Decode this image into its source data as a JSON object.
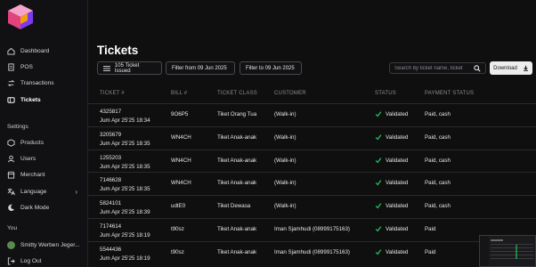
{
  "sidebar": {
    "items": [
      {
        "label": "Dashboard",
        "icon": "home-icon"
      },
      {
        "label": "POS",
        "icon": "receipt-icon"
      },
      {
        "label": "Transactions",
        "icon": "transactions-icon"
      },
      {
        "label": "Tickets",
        "icon": "ticket-icon",
        "active": true
      }
    ],
    "settings_label": "Settings",
    "settings_items": [
      {
        "label": "Products",
        "icon": "products-icon"
      },
      {
        "label": "Users",
        "icon": "users-icon"
      },
      {
        "label": "Merchant",
        "icon": "merchant-icon"
      },
      {
        "label": "Language",
        "icon": "language-icon"
      },
      {
        "label": "Dark Mode",
        "icon": "moon-icon"
      }
    ],
    "you_label": "You",
    "user_name": "Smitty Werben Jeger...",
    "logout_label": "Log Out"
  },
  "main": {
    "title": "Tickets",
    "issued_chip": "105 Ticket Issued",
    "filter_from": "Filter from 09 Jun 2025",
    "filter_to": "Filter to 09 Jun 2025",
    "search_placeholder": "Search by ticket name, ticket",
    "download_label": "Download",
    "columns": [
      "TICKET #",
      "BILL #",
      "TICKET CLASS",
      "CUSTOMER",
      "STATUS",
      "PAYMENT STATUS"
    ],
    "rows": [
      {
        "ticket": "4325817",
        "date": "Jum Apr 25'25 18:34",
        "bill": "9O6P5",
        "cls": "Tiket Orang Tua",
        "cust": "(Walk-in)",
        "status": "Validated",
        "pay": "Paid, cash"
      },
      {
        "ticket": "3205679",
        "date": "Jum Apr 25'25 18:35",
        "bill": "WN4CH",
        "cls": "Tiket Anak-anak",
        "cust": "(Walk-in)",
        "status": "Validated",
        "pay": "Paid, cash"
      },
      {
        "ticket": "1255203",
        "date": "Jum Apr 25'25 18:35",
        "bill": "WN4CH",
        "cls": "Tiket Anak-anak",
        "cust": "(Walk-in)",
        "status": "Validated",
        "pay": "Paid, cash"
      },
      {
        "ticket": "7146628",
        "date": "Jum Apr 25'25 18:35",
        "bill": "WN4CH",
        "cls": "Tiket Anak-anak",
        "cust": "(Walk-in)",
        "status": "Validated",
        "pay": "Paid, cash"
      },
      {
        "ticket": "5824101",
        "date": "Jum Apr 25'25 18:39",
        "bill": "udtE0",
        "cls": "Tiket Dewasa",
        "cust": "(Walk-in)",
        "status": "Validated",
        "pay": "Paid, cash"
      },
      {
        "ticket": "7174614",
        "date": "Jum Apr 25'25 18:19",
        "bill": "t90sz",
        "cls": "Tiket Anak-anak",
        "cust": "Iman Sjamhudi (08999175163)",
        "status": "Validated",
        "pay": "Paid"
      },
      {
        "ticket": "5544436",
        "date": "Jum Apr 25'25 18:19",
        "bill": "t90sz",
        "cls": "Tiket Anak-anak",
        "cust": "Iman Sjamhudi (08999175163)",
        "status": "Validated",
        "pay": "Paid"
      }
    ]
  },
  "colors": {
    "accent_logo": "#a855f7",
    "validated_green": "#22c55e",
    "background": "#0f0f10"
  }
}
